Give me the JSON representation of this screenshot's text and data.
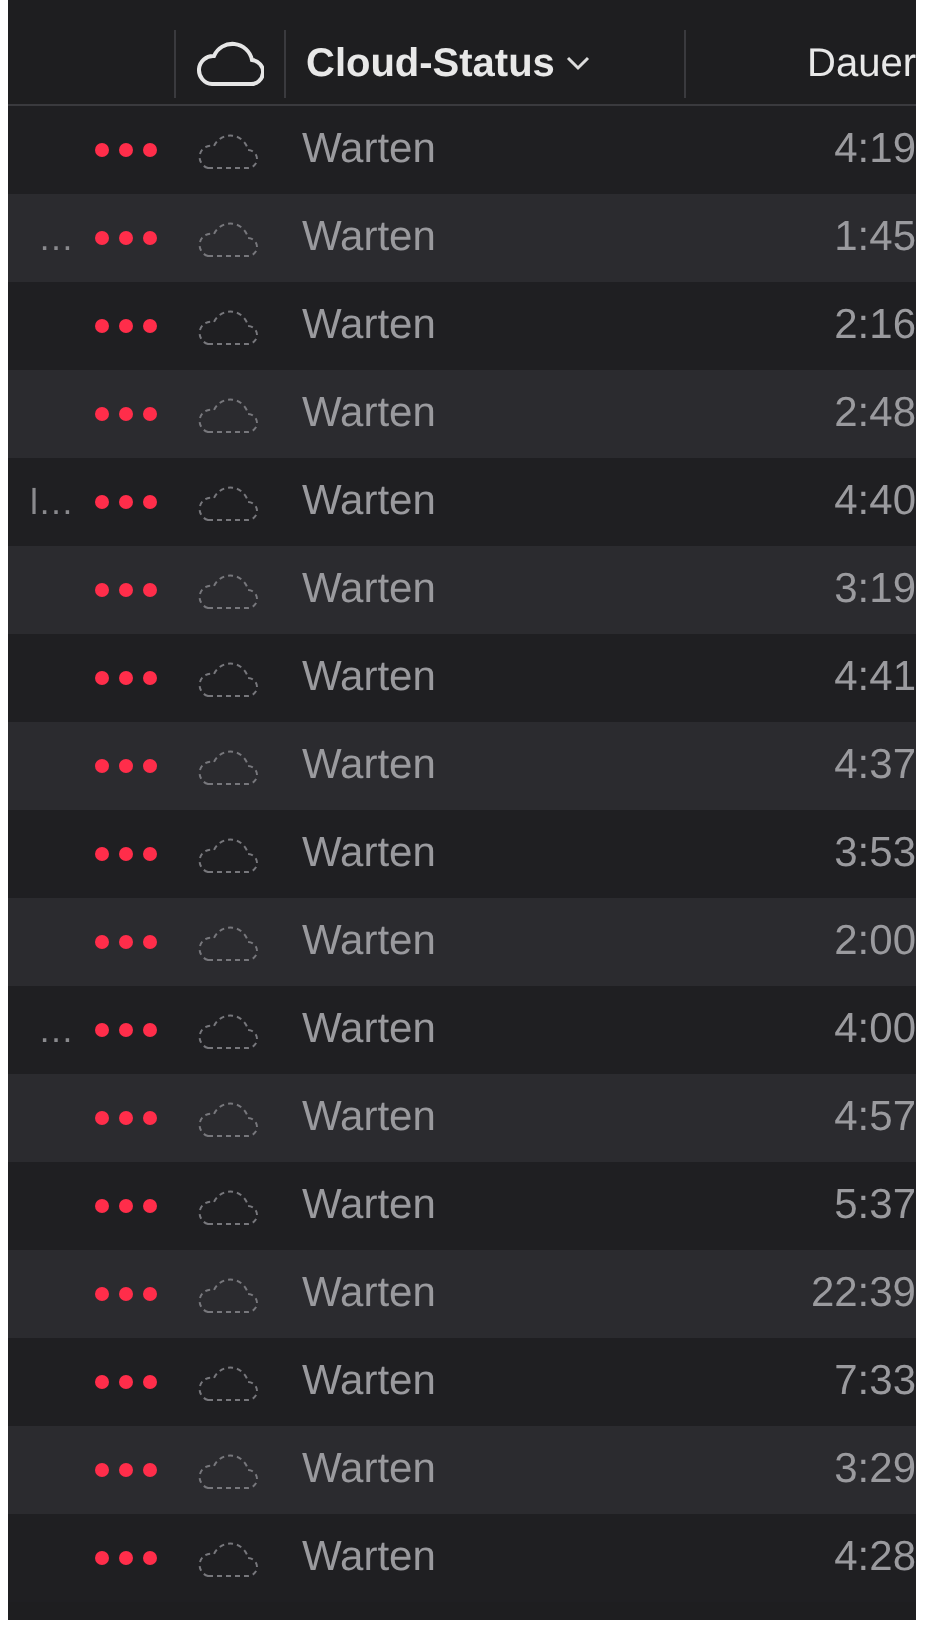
{
  "header": {
    "status_column": "Cloud-Status",
    "duration_column": "Dauer"
  },
  "rows": [
    {
      "status": "Warten",
      "duration": "4:19"
    },
    {
      "title": "…",
      "status": "Warten",
      "duration": "1:45"
    },
    {
      "status": "Warten",
      "duration": "2:16"
    },
    {
      "status": "Warten",
      "duration": "2:48"
    },
    {
      "title": "l…",
      "status": "Warten",
      "duration": "4:40"
    },
    {
      "status": "Warten",
      "duration": "3:19"
    },
    {
      "status": "Warten",
      "duration": "4:41"
    },
    {
      "status": "Warten",
      "duration": "4:37"
    },
    {
      "status": "Warten",
      "duration": "3:53"
    },
    {
      "status": "Warten",
      "duration": "2:00"
    },
    {
      "title": "…",
      "status": "Warten",
      "duration": "4:00"
    },
    {
      "status": "Warten",
      "duration": "4:57"
    },
    {
      "status": "Warten",
      "duration": "5:37"
    },
    {
      "status": "Warten",
      "duration": "22:39"
    },
    {
      "status": "Warten",
      "duration": "7:33"
    },
    {
      "status": "Warten",
      "duration": "3:29"
    },
    {
      "status": "Warten",
      "duration": "4:28"
    }
  ]
}
